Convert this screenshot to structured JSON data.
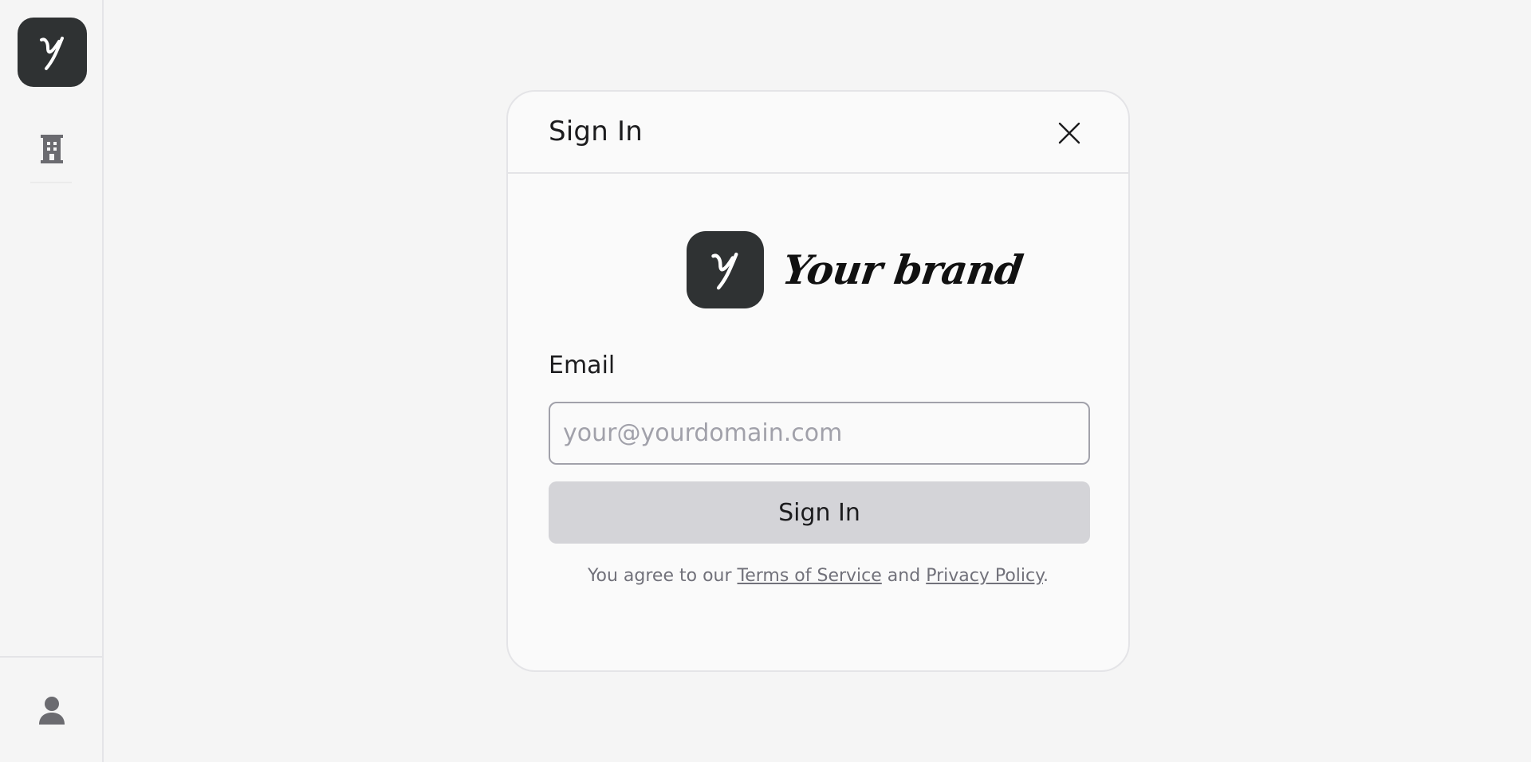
{
  "sidebar": {
    "logo_letter": "Y",
    "items": [
      {
        "icon": "building-icon"
      }
    ],
    "bottom": {
      "icon": "user-icon"
    }
  },
  "modal": {
    "title": "Sign In",
    "brand": {
      "logo_letter": "Y",
      "name": "Your brand"
    },
    "email_label": "Email",
    "email_placeholder": "your@yourdomain.com",
    "email_value": "",
    "submit_label": "Sign In",
    "terms": {
      "prefix": "You agree to our ",
      "tos_label": "Terms of Service",
      "middle": " and ",
      "privacy_label": "Privacy Policy",
      "suffix": "."
    }
  },
  "colors": {
    "background": "#f5f5f5",
    "logo_bg": "#2f3233",
    "button_bg": "#d4d4d8",
    "muted_text": "#71717a",
    "border": "#e4e4e7"
  }
}
